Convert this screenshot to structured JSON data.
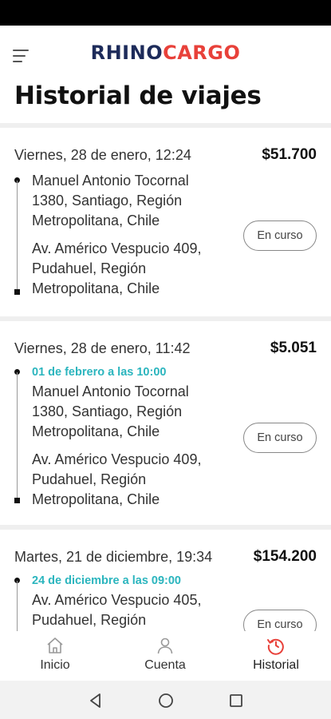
{
  "app": {
    "logo_part1": "RHINO",
    "logo_part2": "CARGO",
    "title": "Historial de viajes",
    "colors": {
      "brand_dark": "#1d2b5a",
      "brand_red": "#e8413a",
      "accent_teal": "#2bb5be"
    }
  },
  "trips": [
    {
      "date": "Viernes, 28 de enero, 12:24",
      "price": "$51.700",
      "schedule": "",
      "origin": "Manuel Antonio Tocornal 1380, Santiago, Región Metropolitana, Chile",
      "destination": "Av. Américo Vespucio 409, Pudahuel, Región Metropolitana, Chile",
      "status": "En curso"
    },
    {
      "date": "Viernes, 28 de enero, 11:42",
      "price": "$5.051",
      "schedule": "01 de febrero a las 10:00",
      "origin": "Manuel Antonio Tocornal 1380, Santiago, Región Metropolitana, Chile",
      "destination": "Av. Américo Vespucio 409, Pudahuel, Región Metropolitana, Chile",
      "status": "En curso"
    },
    {
      "date": "Martes, 21 de diciembre, 19:34",
      "price": "$154.200",
      "schedule": "24 de diciembre a las 09:00",
      "origin": "Av. Américo Vespucio 405, Pudahuel, Región",
      "destination": "",
      "status": "En curso"
    }
  ],
  "bottom_nav": {
    "items": [
      {
        "label": "Inicio",
        "icon": "home-icon"
      },
      {
        "label": "Cuenta",
        "icon": "user-icon"
      },
      {
        "label": "Historial",
        "icon": "history-icon",
        "active": true
      }
    ]
  },
  "system_nav": {
    "icons": [
      "back-icon",
      "home-circle-icon",
      "recents-icon"
    ]
  }
}
